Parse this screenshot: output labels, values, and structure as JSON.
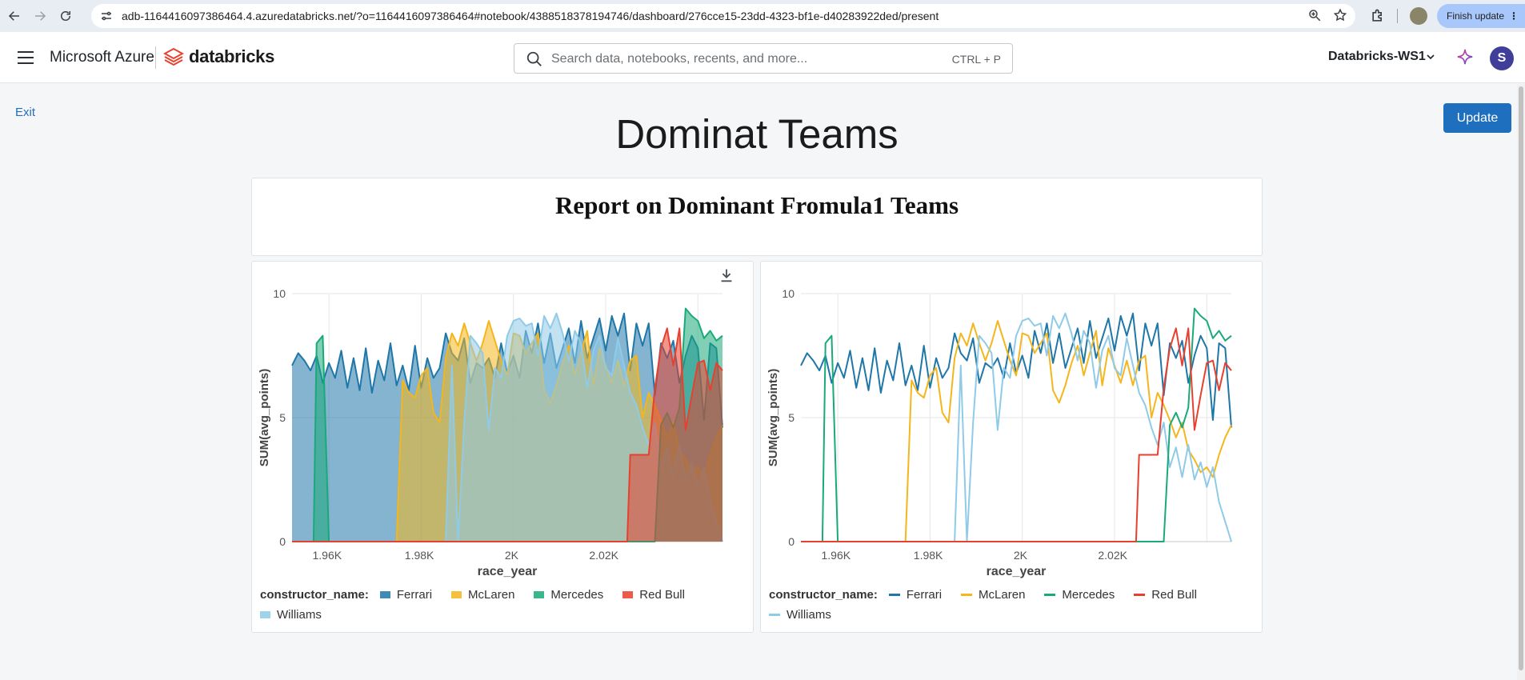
{
  "browser": {
    "url": "adb-1164416097386464.4.azuredatabricks.net/?o=1164416097386464#notebook/4388518378194746/dashboard/276cce15-23dd-4323-bf1e-d40283922ded/present",
    "finish_update_label": "Finish update",
    "icons": [
      "back-arrow-icon",
      "forward-arrow-icon",
      "reload-icon",
      "site-settings-icon",
      "zoom-icon",
      "star-icon",
      "extensions-icon",
      "profile-icon",
      "more-icon"
    ]
  },
  "header": {
    "brand": "Microsoft Azure",
    "product": "databricks",
    "search_placeholder": "Search data, notebooks, recents, and more...",
    "search_shortcut": "CTRL + P",
    "workspace": "Databricks-WS1",
    "avatar_initial": "S"
  },
  "dashboard": {
    "exit_label": "Exit",
    "update_label": "Update",
    "title": "Dominat Teams",
    "report_title": "Report on Dominant Fromula1 Teams"
  },
  "colors": {
    "Ferrari": "#1f77a8",
    "McLaren": "#f5b61c",
    "Mercedes": "#1aa97a",
    "Red Bull": "#e8402e",
    "Williams": "#8fcbe8",
    "accent": "#1f6fbf"
  },
  "legend": {
    "title": "constructor_name:",
    "items": [
      "Ferrari",
      "McLaren",
      "Mercedes",
      "Red Bull",
      "Williams"
    ]
  },
  "chart_data": [
    {
      "type": "area",
      "xlabel": "race_year",
      "ylabel": "SUM(avg_points)",
      "xlim": [
        1950,
        2020
      ],
      "ylim": [
        0,
        10
      ],
      "x_tick_labels": [
        "1.96K",
        "1.98K",
        "2K",
        "2.02K"
      ],
      "y_tick_labels": [
        "0",
        "5",
        "10"
      ],
      "grid": true,
      "legend_position": "bottom",
      "series": [
        {
          "name": "Ferrari",
          "x": [
            1950,
            1951,
            1952,
            1953,
            1954,
            1955,
            1956,
            1957,
            1958,
            1959,
            1960,
            1961,
            1962,
            1963,
            1964,
            1965,
            1966,
            1967,
            1968,
            1969,
            1970,
            1971,
            1972,
            1973,
            1974,
            1975,
            1976,
            1977,
            1978,
            1979,
            1980,
            1981,
            1982,
            1983,
            1984,
            1985,
            1986,
            1987,
            1988,
            1989,
            1990,
            1991,
            1992,
            1993,
            1994,
            1995,
            1996,
            1997,
            1998,
            1999,
            2000,
            2001,
            2002,
            2003,
            2004,
            2005,
            2006,
            2007,
            2008,
            2009,
            2010,
            2011,
            2012,
            2013,
            2014,
            2015,
            2016,
            2017,
            2018,
            2019,
            2020
          ],
          "y": [
            7.1,
            7.6,
            7.3,
            6.9,
            7.5,
            6.4,
            7.2,
            6.6,
            7.7,
            6.2,
            7.4,
            6.1,
            7.8,
            6.0,
            7.3,
            6.5,
            8.0,
            6.3,
            7.1,
            6.1,
            7.9,
            6.2,
            7.4,
            6.6,
            7.0,
            8.4,
            7.6,
            7.3,
            8.2,
            6.4,
            7.2,
            7.0,
            7.4,
            6.6,
            8.0,
            6.8,
            7.5,
            6.6,
            8.5,
            7.6,
            8.8,
            7.2,
            8.4,
            7.0,
            7.8,
            8.6,
            7.2,
            8.9,
            7.4,
            8.2,
            9.0,
            7.7,
            9.1,
            8.3,
            9.2,
            6.9,
            8.8,
            7.9,
            8.8,
            5.9,
            8.0,
            7.4,
            8.1,
            6.4,
            7.5,
            8.3,
            7.8,
            4.9,
            8.0,
            7.8,
            4.6
          ]
        },
        {
          "name": "McLaren",
          "x": [
            1966,
            1967,
            1968,
            1969,
            1970,
            1971,
            1972,
            1973,
            1974,
            1975,
            1976,
            1977,
            1978,
            1979,
            1980,
            1981,
            1982,
            1983,
            1984,
            1985,
            1986,
            1987,
            1988,
            1989,
            1990,
            1991,
            1992,
            1993,
            1994,
            1995,
            1996,
            1997,
            1998,
            1999,
            2000,
            2001,
            2002,
            2003,
            2004,
            2005,
            2006,
            2007,
            2008,
            2009,
            2010,
            2011,
            2012,
            2013,
            2014,
            2015,
            2016,
            2017,
            2018,
            2019,
            2020
          ],
          "y": [
            0,
            0,
            0,
            0,
            0,
            0,
            0,
            0,
            0,
            0,
            0,
            0,
            0,
            0,
            0,
            0,
            0,
            0,
            0,
            0,
            0,
            0,
            0,
            0,
            0,
            0,
            0,
            0,
            0,
            0,
            0,
            0,
            0,
            0,
            0,
            0,
            0,
            0,
            0,
            0,
            0,
            0,
            0,
            0,
            0,
            0,
            0,
            0,
            0,
            0,
            0,
            0,
            0,
            0,
            0
          ]
        },
        {
          "name": "Mercedes",
          "x": [
            1954,
            1955,
            2010,
            2011,
            2012,
            2013,
            2014,
            2015,
            2016,
            2017,
            2018,
            2019,
            2020
          ],
          "y": [
            8.0,
            8.3,
            4.7,
            5.2,
            4.6,
            5.4,
            9.4,
            9.1,
            8.9,
            8.2,
            8.5,
            8.1,
            8.3
          ]
        },
        {
          "name": "Red Bull",
          "x": [
            2005,
            2006,
            2007,
            2008,
            2009,
            2010,
            2011,
            2012,
            2013,
            2014,
            2015,
            2016,
            2017,
            2018,
            2019,
            2020
          ],
          "y": [
            3.5,
            3.5,
            3.5,
            3.5,
            6.2,
            7.8,
            8.6,
            7.1,
            8.6,
            4.5,
            5.9,
            7.2,
            7.3,
            6.1,
            7.2,
            6.9
          ]
        },
        {
          "name": "Williams",
          "x": [
            1975,
            1976,
            1977,
            1978,
            1979,
            1980,
            1981,
            1982,
            1983,
            1984,
            1985,
            1986,
            1987,
            1988,
            1989,
            1990,
            1991,
            1992,
            1993,
            1994,
            1995,
            1996,
            1997,
            1998,
            1999,
            2000,
            2001,
            2002,
            2003,
            2004,
            2005,
            2006,
            2007,
            2008,
            2009,
            2010,
            2011,
            2012,
            2013,
            2014,
            2015,
            2016,
            2017,
            2018,
            2019,
            2020
          ],
          "y": [
            0,
            7.1,
            0,
            4.8,
            8.3,
            8.0,
            7.6,
            4.5,
            7.0,
            6.6,
            8.3,
            8.9,
            9.0,
            8.7,
            8.8,
            7.5,
            9.1,
            8.6,
            9.2,
            8.4,
            7.3,
            8.5,
            8.0,
            6.2,
            7.7,
            8.3,
            7.0,
            6.7,
            8.2,
            7.1,
            6.0,
            5.5,
            4.6,
            3.9,
            4.8,
            3.0,
            3.8,
            2.6,
            3.9,
            2.5,
            3.2,
            2.2,
            3.0,
            1.6,
            0.8,
            0.0
          ]
        }
      ]
    },
    {
      "type": "line",
      "xlabel": "race_year",
      "ylabel": "SUM(avg_points)",
      "xlim": [
        1950,
        2020
      ],
      "ylim": [
        0,
        10
      ],
      "x_tick_labels": [
        "1.96K",
        "1.98K",
        "2K",
        "2.02K"
      ],
      "y_tick_labels": [
        "0",
        "5",
        "10"
      ],
      "grid": true,
      "legend_position": "bottom",
      "series": "same as previous chart"
    }
  ]
}
